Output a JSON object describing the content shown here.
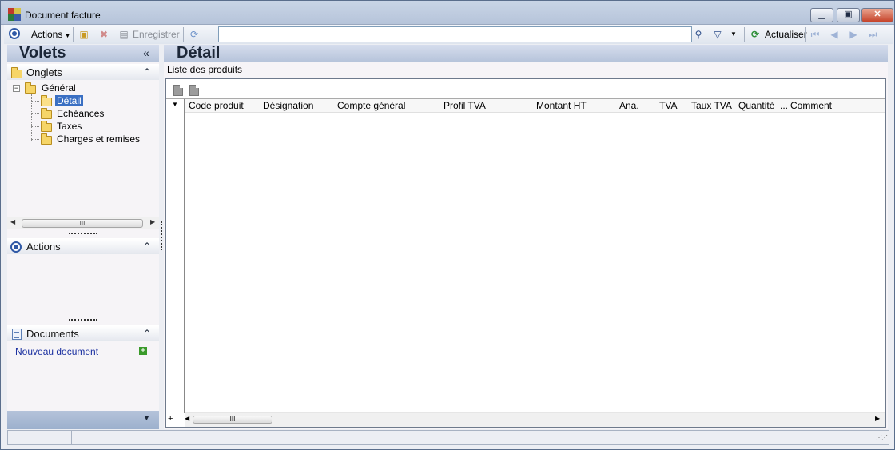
{
  "window": {
    "title": "Document facture",
    "minimize": "▁",
    "maximize": "▣",
    "close": "✕"
  },
  "toolbar": {
    "actions_label": "Actions",
    "save_label": "Enregistrer",
    "search_value": "",
    "refresh_label": "Actualiser"
  },
  "left": {
    "volets_title": "Volets",
    "collapse_glyph": "«",
    "onglets": {
      "label": "Onglets",
      "toggle": "⌃",
      "tree": {
        "root": "Général",
        "children": [
          "Détail",
          "Echéances",
          "Taxes",
          "Charges et remises"
        ],
        "selected_index": 0
      }
    },
    "scroll_thumb": "III",
    "actions_section": {
      "label": "Actions",
      "toggle": "⌃"
    },
    "documents_section": {
      "label": "Documents",
      "toggle": "⌃",
      "new_doc": "Nouveau document"
    },
    "bottom_glyph": "▼"
  },
  "main": {
    "title": "Détail",
    "group_label": "Liste des produits",
    "columns": [
      "Code produit",
      "Désignation",
      "Compte général",
      "Profil TVA",
      "Montant HT",
      "Ana.",
      "TVA",
      "Taux TVA",
      "Quantité",
      "...",
      "Comment"
    ],
    "indicator_glyph": "▼",
    "add_row": "+",
    "scroll_thumb": "III"
  },
  "colors": {
    "header_gradient_top": "#d6dded",
    "header_gradient_bottom": "#b5c3da",
    "selection": "#3a6fc3",
    "link": "#1a2fa0"
  }
}
